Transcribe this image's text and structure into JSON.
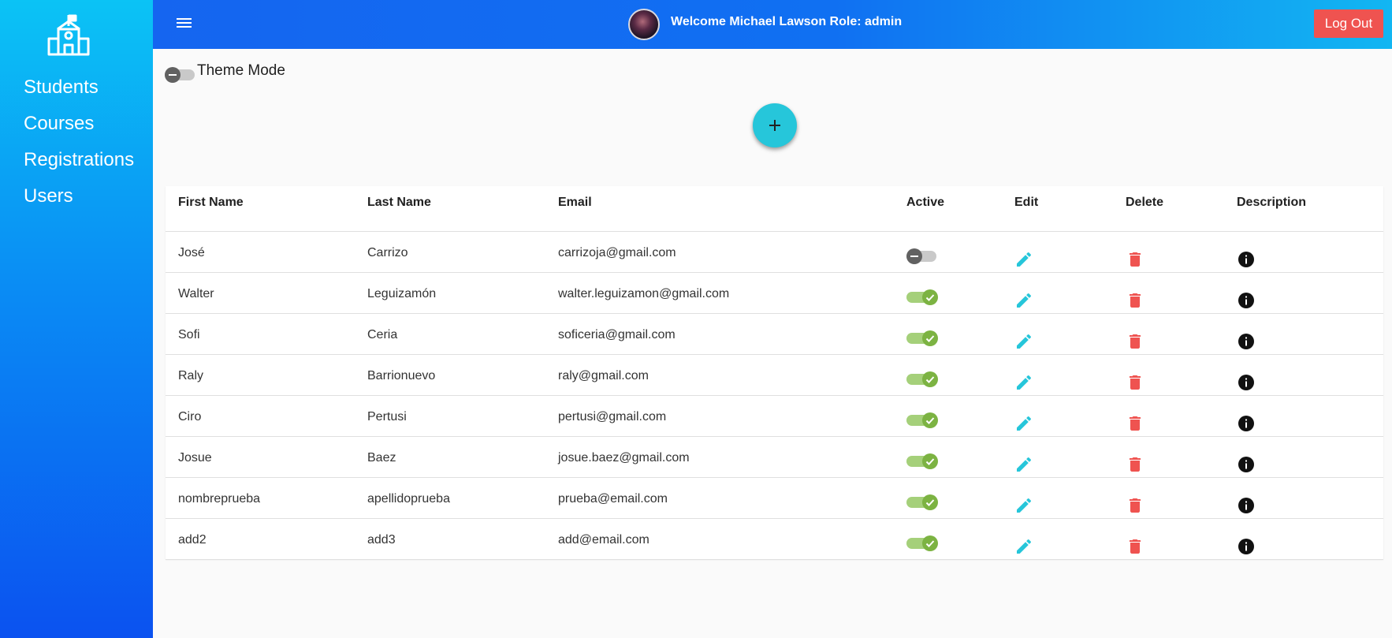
{
  "sidebar": {
    "logo_icon": "school-icon",
    "items": [
      {
        "label": "Students"
      },
      {
        "label": "Courses"
      },
      {
        "label": "Registrations"
      },
      {
        "label": "Users"
      }
    ]
  },
  "header": {
    "menu_icon": "hamburger-menu-icon",
    "welcome": "Welcome Michael Lawson Role: admin",
    "logout_label": "Log Out"
  },
  "theme": {
    "label": "Theme Mode",
    "enabled": false
  },
  "add_button_icon": "plus-icon",
  "table": {
    "columns": [
      "First Name",
      "Last Name",
      "Email",
      "Active",
      "Edit",
      "Delete",
      "Description"
    ],
    "rows": [
      {
        "first": "José",
        "last": "Carrizo",
        "email": "carrizoja@gmail.com",
        "active": false
      },
      {
        "first": "Walter",
        "last": "Leguizamón",
        "email": "walter.leguizamon@gmail.com",
        "active": true
      },
      {
        "first": "Sofi",
        "last": "Ceria",
        "email": "soficeria@gmail.com",
        "active": true
      },
      {
        "first": "Raly",
        "last": "Barrionuevo",
        "email": "raly@gmail.com",
        "active": true
      },
      {
        "first": "Ciro",
        "last": "Pertusi",
        "email": "pertusi@gmail.com",
        "active": true
      },
      {
        "first": "Josue",
        "last": "Baez",
        "email": "josue.baez@gmail.com",
        "active": true
      },
      {
        "first": "nombreprueba",
        "last": "apellidoprueba",
        "email": "prueba@email.com",
        "active": true
      },
      {
        "first": "add2",
        "last": "add3",
        "email": "add@email.com",
        "active": true
      }
    ]
  },
  "colors": {
    "sidebar_top": "#0bc3f5",
    "sidebar_bottom": "#0b52f0",
    "header": "#1565f0",
    "logout": "#ef5350",
    "fab": "#26c6da",
    "edit_icon": "#26c6da",
    "delete_icon": "#ef5350",
    "toggle_on": "#7cb342"
  }
}
